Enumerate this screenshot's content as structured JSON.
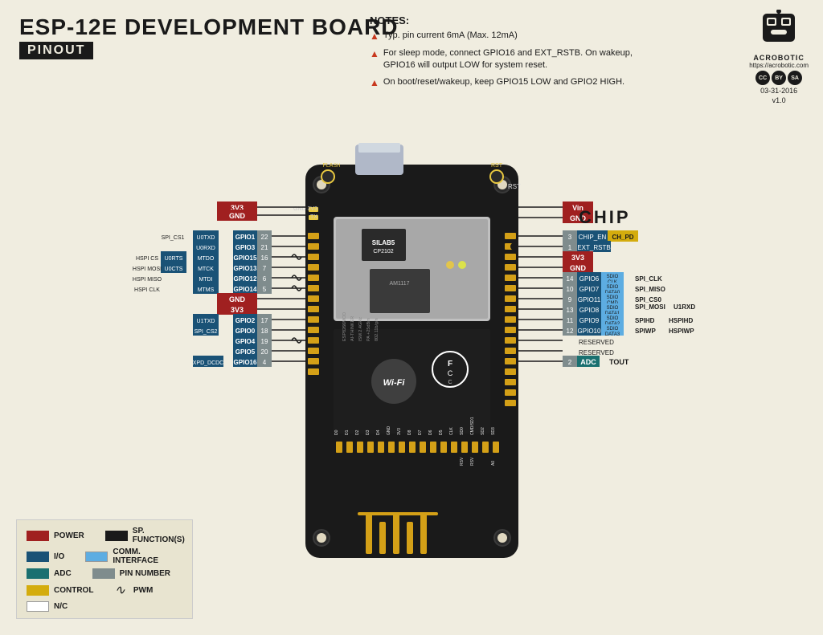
{
  "header": {
    "title": "ESP-12E DEVELOPMENT BOARD",
    "subtitle": "PINOUT"
  },
  "notes": {
    "title": "NOTES:",
    "items": [
      "Typ. pin current 6mA (Max. 12mA)",
      "For sleep mode, connect GPIO16 and EXT_RSTB. On wakeup, GPIO16 will output LOW for system reset.",
      "On boot/reset/wakeup, keep GPIO15 LOW and GPIO2 HIGH."
    ]
  },
  "logo": {
    "url": "https://acrobotic.com",
    "date": "03-31-2016",
    "version": "v1.0",
    "name": "ACROBOTIC"
  },
  "legend": {
    "items": [
      {
        "label": "POWER",
        "color": "#a02020"
      },
      {
        "label": "I/O",
        "color": "#1a5276"
      },
      {
        "label": "ADC",
        "color": "#1a7070"
      },
      {
        "label": "CONTROL",
        "color": "#d4ac0d"
      },
      {
        "label": "N/C",
        "color": "white"
      },
      {
        "label": "SP. FUNCTION(S)",
        "color": "#1a1a1a"
      },
      {
        "label": "COMM. INTERFACE",
        "color": "#5dade2"
      },
      {
        "label": "PIN NUMBER",
        "color": "#7f8c8d"
      },
      {
        "label": "PWM",
        "color": null
      }
    ]
  },
  "left_pins": [
    {
      "top_labels": [],
      "gpio": "GPIO1",
      "num": "22",
      "aux": "U0TXD",
      "extra": "SPI_CS1",
      "pwm": false
    },
    {
      "top_labels": [],
      "gpio": "GPIO3",
      "num": "21",
      "aux": "U0RXD",
      "extra": "",
      "pwm": false
    },
    {
      "top_labels": [
        "HSPI CS"
      ],
      "gpio": "GPIO15",
      "num": "16",
      "aux": "MTDO",
      "extra": "U0RTS",
      "pwm": true
    },
    {
      "top_labels": [
        "HSPI MOSI"
      ],
      "gpio": "GPIO13",
      "num": "7",
      "aux": "MTCK",
      "extra": "U0CTS",
      "pwm": false
    },
    {
      "top_labels": [
        "HSPI MISO"
      ],
      "gpio": "GPIO12",
      "num": "6",
      "aux": "MTDI",
      "extra": "",
      "pwm": true
    },
    {
      "top_labels": [
        "HSPI CLK"
      ],
      "gpio": "GPIO14",
      "num": "5",
      "aux": "MTMS",
      "extra": "",
      "pwm": true
    },
    {
      "top_labels": [],
      "gpio": null,
      "num": null,
      "aux": "GND",
      "extra": "",
      "pwm": false,
      "special": "GND"
    },
    {
      "top_labels": [],
      "gpio": null,
      "num": null,
      "aux": "3V3",
      "extra": "",
      "pwm": false,
      "special": "3V3"
    },
    {
      "top_labels": [],
      "gpio": "GPIO2",
      "num": "17",
      "aux": "U1TXD",
      "extra": "",
      "pwm": false
    },
    {
      "top_labels": [],
      "gpio": "GPIO0",
      "num": "18",
      "aux": "SPI_CS2",
      "extra": "",
      "pwm": false
    },
    {
      "top_labels": [],
      "gpio": "GPIO4",
      "num": "19",
      "aux": "",
      "extra": "",
      "pwm": true
    },
    {
      "top_labels": [],
      "gpio": "GPIO5",
      "num": "20",
      "aux": "",
      "extra": "",
      "pwm": false
    },
    {
      "top_labels": [],
      "gpio": "GPIO16",
      "num": "4",
      "aux": "XPD_DCDC",
      "extra": "",
      "pwm": false
    }
  ],
  "right_pins": [
    {
      "gpio": null,
      "special": "Vin",
      "type": "power"
    },
    {
      "gpio": null,
      "special": "GND",
      "type": "power"
    },
    {
      "num": "3",
      "gpio": "CHIP_EN",
      "aux": "CH_PD",
      "extra": "",
      "type": "control"
    },
    {
      "num": "1",
      "gpio": "EXT_RSTB",
      "aux": "",
      "extra": "",
      "type": "io",
      "dot": true
    },
    {
      "gpio": null,
      "special": "3V3",
      "type": "power"
    },
    {
      "gpio": null,
      "special": "GND",
      "type": "power"
    },
    {
      "num": "14",
      "gpio": "GPIO6",
      "aux": "SDIO CLK",
      "extra": "SPI_CLK",
      "type": "io"
    },
    {
      "num": "10",
      "gpio": "GPIO7",
      "aux": "SDIO DATA0",
      "extra": "SPI_MISO",
      "type": "io"
    },
    {
      "num": "9",
      "gpio": "GPIO11",
      "aux": "SDIO CMD",
      "extra": "SPI_CS0",
      "type": "io"
    },
    {
      "num": "13",
      "gpio": "GPIO8",
      "aux": "SDIO DATA1",
      "extra": "SPI_MOSI U1RXD",
      "type": "io"
    },
    {
      "num": "11",
      "gpio": "GPIO9",
      "aux": "SDIO DATA2",
      "extra": "SPIHD HSPIHD",
      "type": "io"
    },
    {
      "num": "12",
      "gpio": "GPIO10",
      "aux": "SDIO DATA3",
      "extra": "SPIWP HSPIWP",
      "type": "io"
    },
    {
      "gpio": null,
      "special": "RESERVED",
      "type": "nc"
    },
    {
      "gpio": null,
      "special": "RESERVED",
      "type": "nc"
    },
    {
      "num": "2",
      "gpio": "ADC",
      "aux": "TOUT",
      "extra": "",
      "type": "adc"
    }
  ],
  "chip_label": "CHIP"
}
